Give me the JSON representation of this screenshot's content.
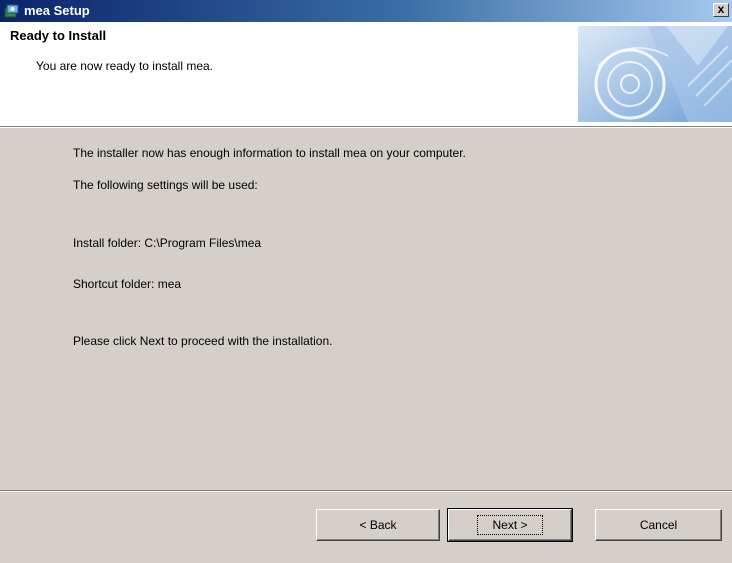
{
  "window": {
    "title": "mea Setup",
    "close_label": "x"
  },
  "header": {
    "title": "Ready to Install",
    "subtitle": "You are now ready to install mea."
  },
  "body": {
    "line1": "The installer now has enough information to install mea on your computer.",
    "line2": "The following settings will be used:",
    "install_folder": "Install folder:  C:\\Program Files\\mea",
    "shortcut_folder": "Shortcut folder:  mea",
    "instruction": "Please click Next to proceed with the installation."
  },
  "buttons": {
    "back": "< Back",
    "next": "Next >",
    "cancel": "Cancel"
  },
  "icons": {
    "title": "installer-icon",
    "header": "cd-disc-icon"
  }
}
